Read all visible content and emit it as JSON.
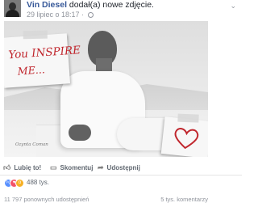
{
  "post": {
    "author": "Vin Diesel",
    "action": " dodał(a) nowe zdjęcie.",
    "timestamp": "29 lipiec o 18:17 ·"
  },
  "photo": {
    "note_line1": "You INSPIRE",
    "note_line2": "ME...",
    "signature": "Ozynta Coman"
  },
  "actions": {
    "like": "Lubię to!",
    "comment": "Skomentuj",
    "share": "Udostępnij"
  },
  "reactions": {
    "count": "488 tys."
  },
  "stats": {
    "shares": "11 797 ponownych udostępnień",
    "comments": "5 tys. komentarzy"
  },
  "colors": {
    "link": "#365899",
    "meta": "#90949c",
    "note_text": "#c0262d",
    "like": "#5890ff",
    "love": "#f25268",
    "wow": "#f7b125"
  }
}
